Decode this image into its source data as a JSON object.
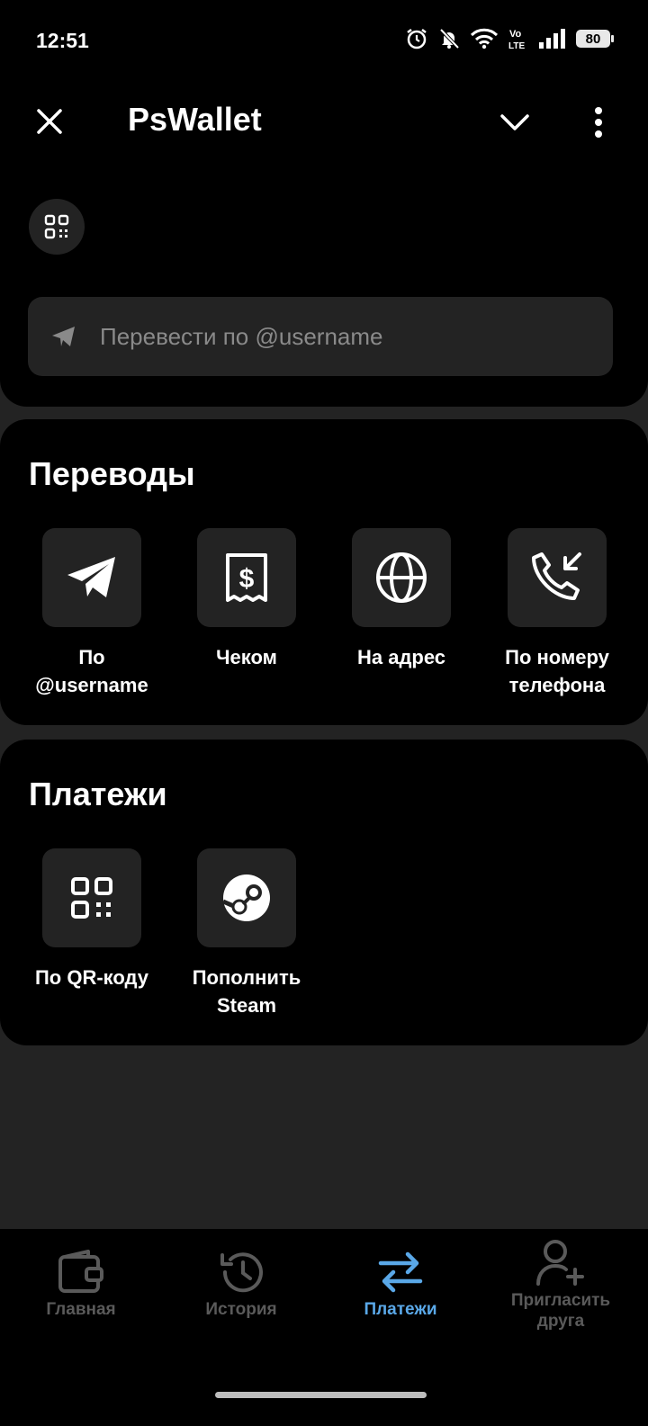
{
  "status": {
    "time": "12:51",
    "battery": "80"
  },
  "header": {
    "title": "PsWallet"
  },
  "search": {
    "placeholder": "Перевести по @username"
  },
  "transfers": {
    "title": "Переводы",
    "items": [
      {
        "label": "По\n@username",
        "icon": "paper-plane-icon"
      },
      {
        "label": "Чеком",
        "icon": "receipt-dollar-icon"
      },
      {
        "label": "На адрес",
        "icon": "globe-icon"
      },
      {
        "label": "По номеру\nтелефона",
        "icon": "phone-incoming-icon"
      }
    ]
  },
  "payments": {
    "title": "Платежи",
    "items": [
      {
        "label": "По QR-коду",
        "icon": "qr-code-icon"
      },
      {
        "label": "Пополнить\nSteam",
        "icon": "steam-icon"
      }
    ]
  },
  "nav": {
    "items": [
      {
        "label": "Главная",
        "icon": "wallet-icon",
        "active": false
      },
      {
        "label": "История",
        "icon": "history-icon",
        "active": false
      },
      {
        "label": "Платежи",
        "icon": "transfer-arrows-icon",
        "active": true
      },
      {
        "label": "Пригласить\nдруга",
        "icon": "add-user-icon",
        "active": false
      }
    ],
    "active_color": "#5aa8e8",
    "inactive_color": "#5a5a5a"
  }
}
